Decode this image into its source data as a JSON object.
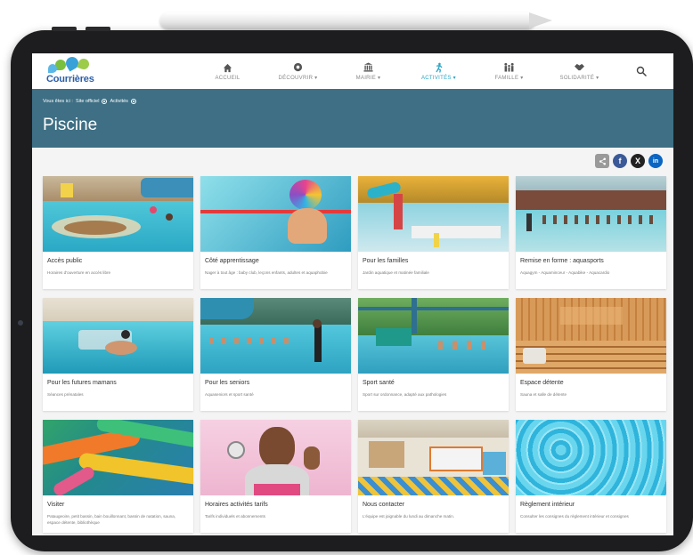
{
  "site": {
    "logo_text": "Courrières"
  },
  "nav": [
    {
      "label": "ACCUEIL",
      "icon": "home-icon"
    },
    {
      "label": "DÉCOUVRIR",
      "icon": "eye-icon"
    },
    {
      "label": "MAIRIE",
      "icon": "town-hall-icon"
    },
    {
      "label": "ACTIVITÉS",
      "icon": "runner-icon"
    },
    {
      "label": "FAMILLE",
      "icon": "family-icon"
    },
    {
      "label": "SOLIDARITÉ",
      "icon": "handshake-icon"
    }
  ],
  "breadcrumb": {
    "prefix": "Vous êtes ici :",
    "items": [
      "Site officiel",
      "Activités"
    ]
  },
  "page": {
    "title": "Piscine"
  },
  "share": [
    {
      "icon": "share-icon",
      "color": "#9a9a9a"
    },
    {
      "icon": "facebook-icon",
      "color": "#3b5998"
    },
    {
      "icon": "x-icon",
      "color": "#222222"
    },
    {
      "icon": "linkedin-icon",
      "color": "#0a66c2"
    }
  ],
  "cards": [
    {
      "title": "Accès public",
      "desc": "Horaires d'ouverture en accès libre"
    },
    {
      "title": "Côté apprentissage",
      "desc": "Nager à tout âge : baby club, leçons enfants, adultes et aquaphobie"
    },
    {
      "title": "Pour les familles",
      "desc": "Jardin aquatique et matinée familiale"
    },
    {
      "title": "Remise en forme : aquasports",
      "desc": "Aquagym - Aquaminceur - Aquabike - Aquacardio"
    },
    {
      "title": "Pour les futures mamans",
      "desc": "Séances prénatales"
    },
    {
      "title": "Pour les seniors",
      "desc": "Aquaseniors et sport santé"
    },
    {
      "title": "Sport santé",
      "desc": "Sport sur ordonnance, adapté aux pathologies"
    },
    {
      "title": "Espace détente",
      "desc": "Sauna et salle de détente"
    },
    {
      "title": "Visiter",
      "desc": "Pataugeoire, petit bassin, bain bouillonnant, bassin de natation, sauna, espace détente, bibliothèque"
    },
    {
      "title": "Horaires activités tarifs",
      "desc": "Tarifs individuels et abonnements"
    },
    {
      "title": "Nous contacter",
      "desc": "L'équipe est joignable du lundi au dimanche matin."
    },
    {
      "title": "Règlement intérieur",
      "desc": "Consulter les consignes du règlement intérieur et consignes"
    }
  ],
  "colors": {
    "banner": "#3e6f84",
    "accent": "#29a3c4"
  }
}
